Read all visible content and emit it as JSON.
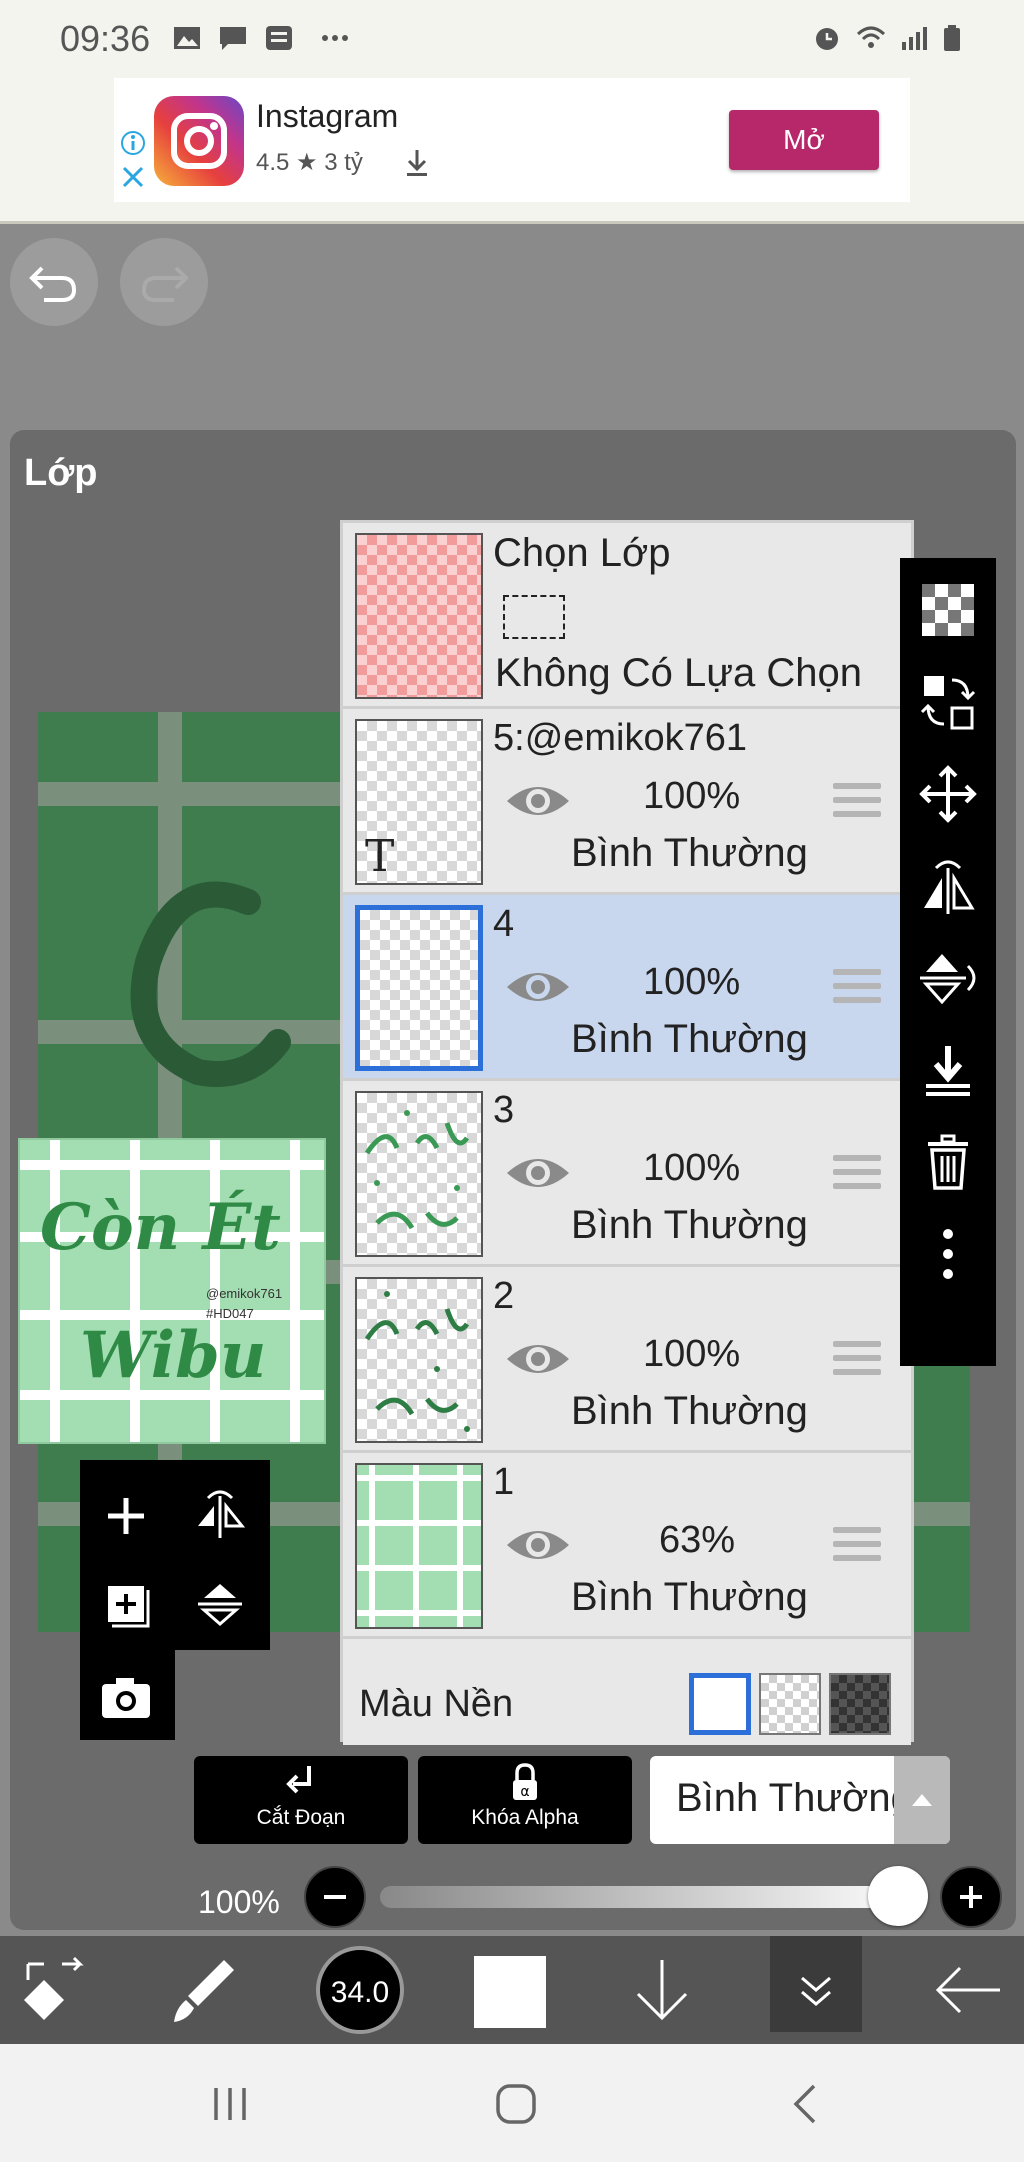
{
  "status_bar": {
    "time": "09:36",
    "left_icons": [
      "gallery-icon",
      "message-icon",
      "baomoi-icon",
      "more-icon"
    ],
    "right_icons": [
      "alarm-icon",
      "wifi-icon",
      "signal-icon",
      "battery-icon"
    ]
  },
  "ad": {
    "app_name": "Instagram",
    "rating_text": "4.5 ★ 3 tỷ",
    "button_label": "Mở"
  },
  "panel": {
    "title": "Lớp"
  },
  "layers": {
    "selection": {
      "title": "Chọn Lớp",
      "status": "Không Có Lựa Chọn"
    },
    "items": [
      {
        "name": "5:@emikok761",
        "opacity": "100%",
        "blend": "Bình Thường",
        "selected": false
      },
      {
        "name": "4",
        "opacity": "100%",
        "blend": "Bình Thường",
        "selected": true
      },
      {
        "name": "3",
        "opacity": "100%",
        "blend": "Bình Thường",
        "selected": false
      },
      {
        "name": "2",
        "opacity": "100%",
        "blend": "Bình Thường",
        "selected": false
      },
      {
        "name": "1",
        "opacity": "63%",
        "blend": "Bình Thường",
        "selected": false
      }
    ],
    "background": {
      "label": "Màu Nền",
      "options": [
        "white",
        "transparent",
        "dark-checker"
      ],
      "selected": "white"
    }
  },
  "thumbnail_text": {
    "layer5": "T",
    "ref_art_top": "Còn Ét",
    "ref_art_bottom": "Wibu",
    "ref_watermark_1": "@emikok761",
    "ref_watermark_2": "#HD047"
  },
  "actions": {
    "clipping_label": "Cắt Đoạn",
    "alpha_lock_label": "Khóa Alpha",
    "blend_mode": "Bình Thường"
  },
  "opacity_slider": {
    "value_label": "100%",
    "value": 1.0
  },
  "bottom_tools": {
    "brush_size": "34.0"
  },
  "colors": {
    "accent_blue": "#2d6fd8",
    "ad_button": "#b7286a",
    "canvas_green": "#3f7d4e",
    "ref_green": "#a3ddb2"
  }
}
